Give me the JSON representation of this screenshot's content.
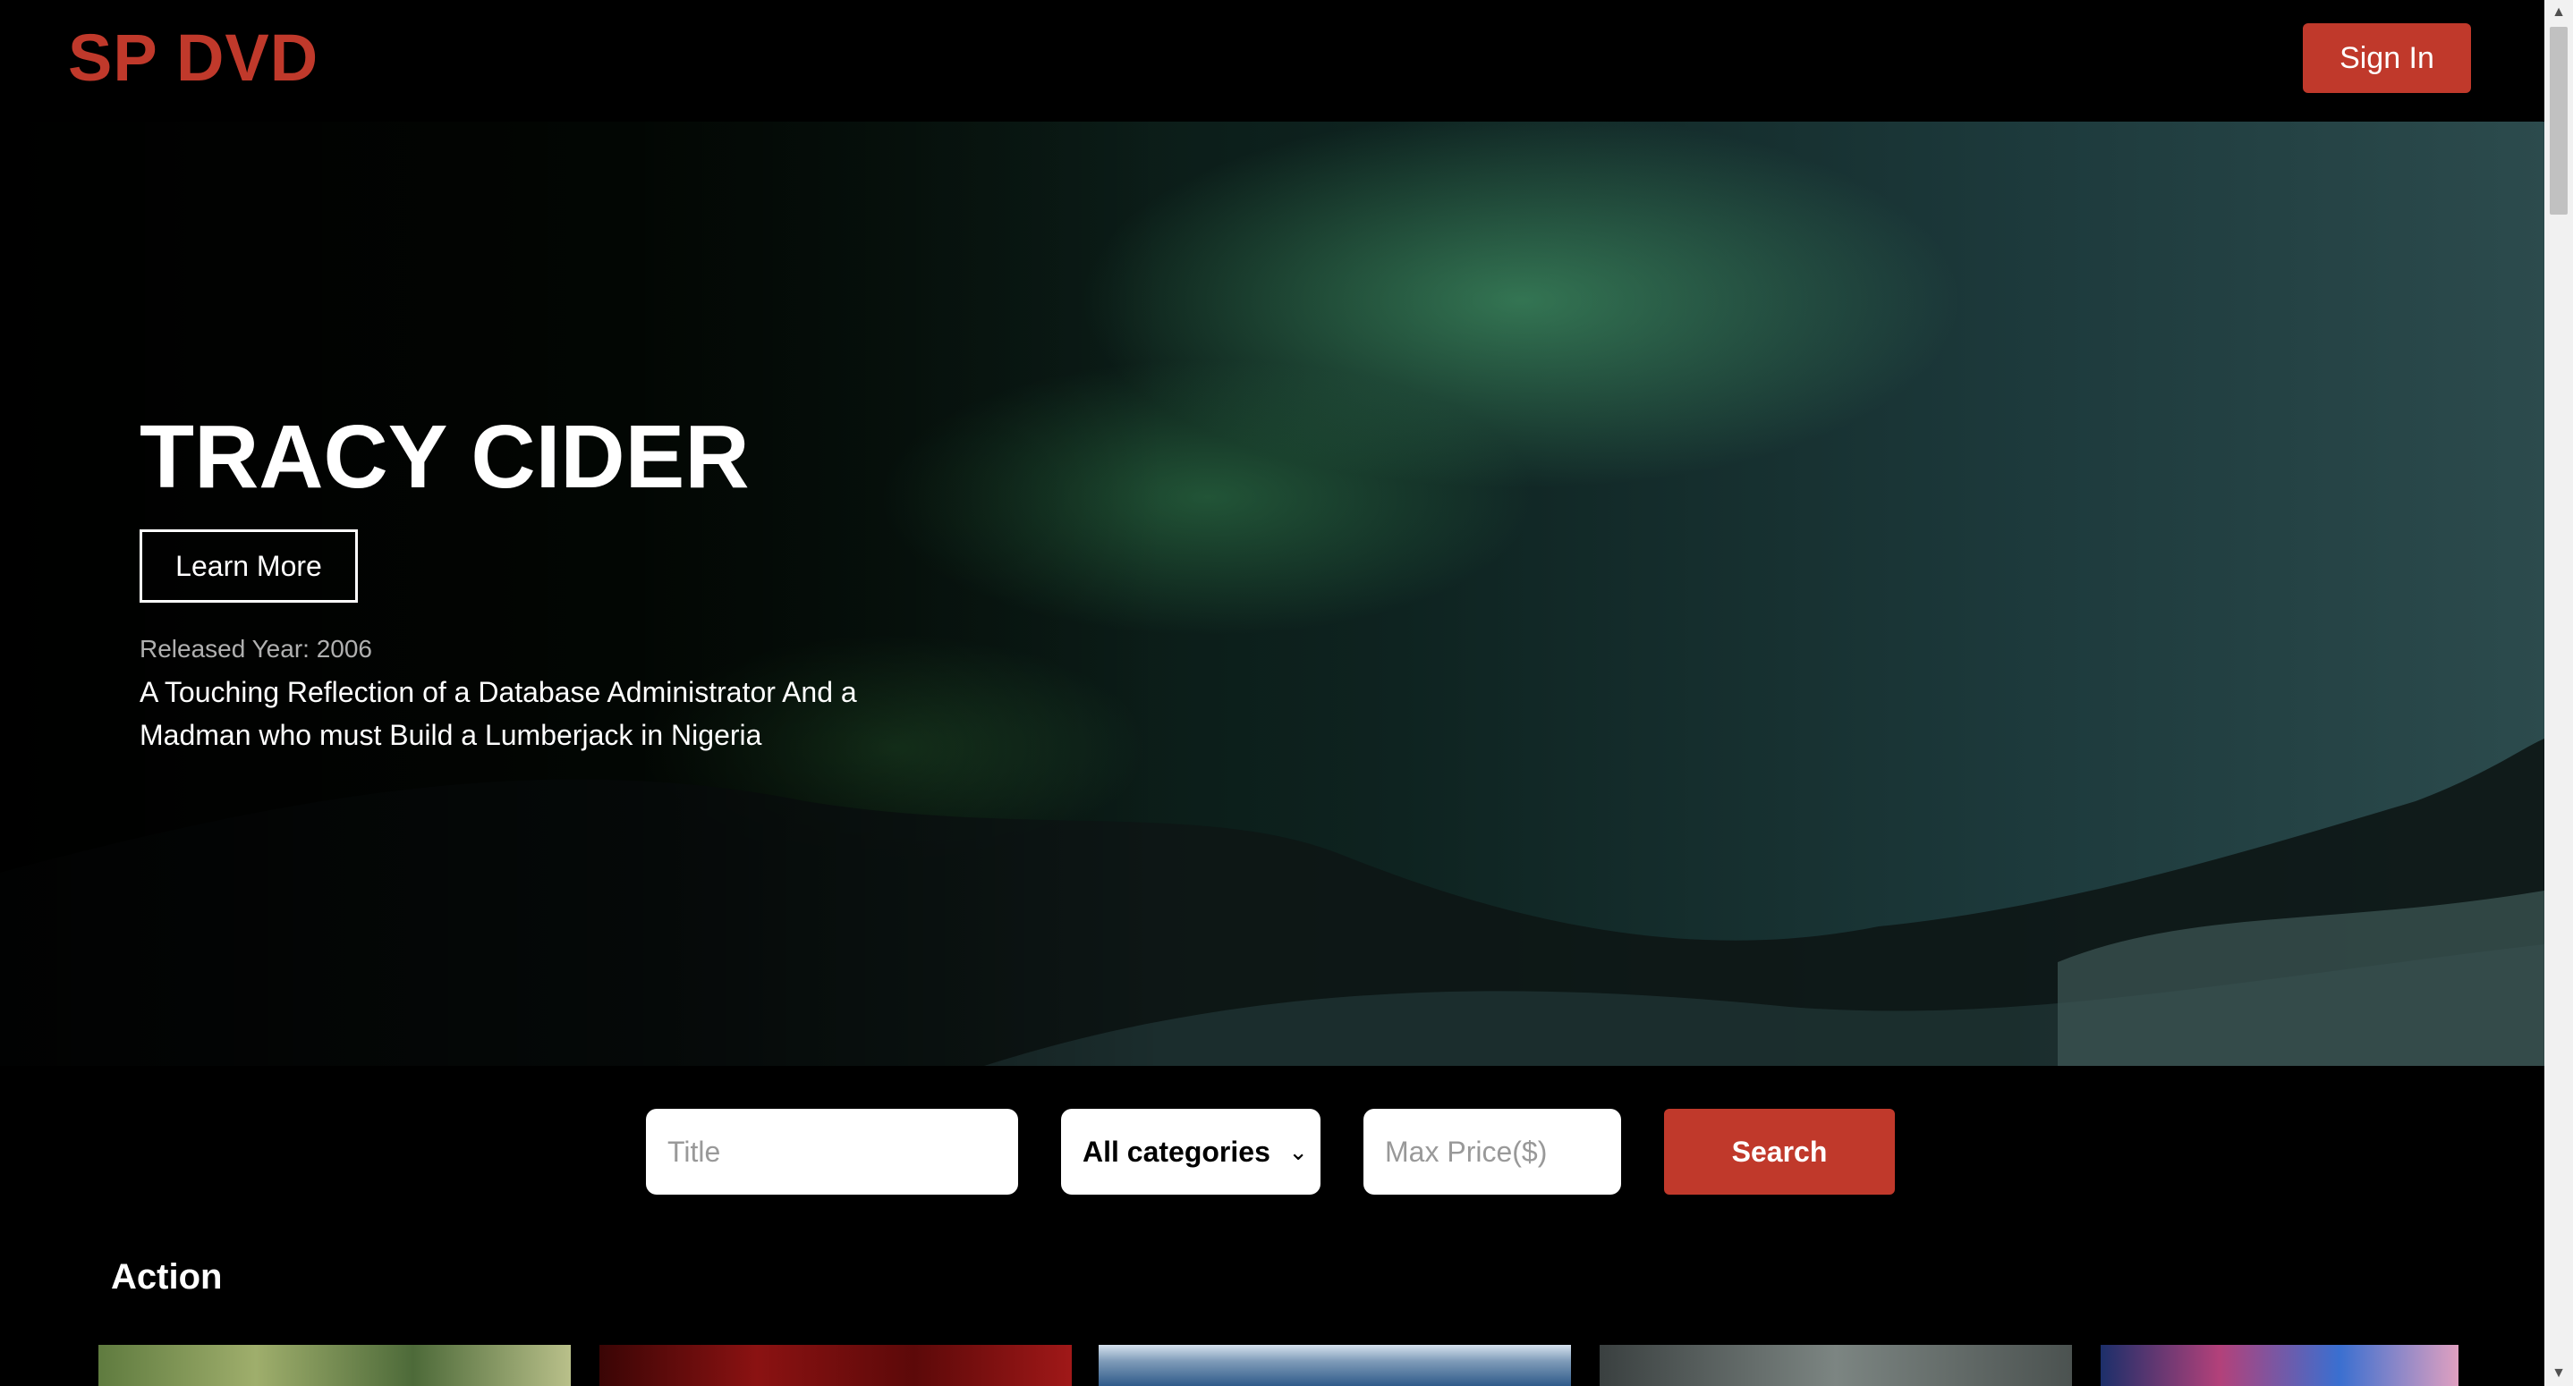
{
  "header": {
    "brand": "SP DVD",
    "signin_label": "Sign In"
  },
  "hero": {
    "title": "TRACY CIDER",
    "learn_more_label": "Learn More",
    "release_label": "Released Year: 2006",
    "description": "A Touching Reflection of a Database Administrator And a Madman who must Build a Lumberjack in Nigeria"
  },
  "search": {
    "title_placeholder": "Title",
    "category_selected": "All categories",
    "price_placeholder": "Max Price($)",
    "button_label": "Search"
  },
  "categories": [
    {
      "name": "Action"
    }
  ],
  "colors": {
    "accent": "#c0392b",
    "background": "#000000"
  }
}
